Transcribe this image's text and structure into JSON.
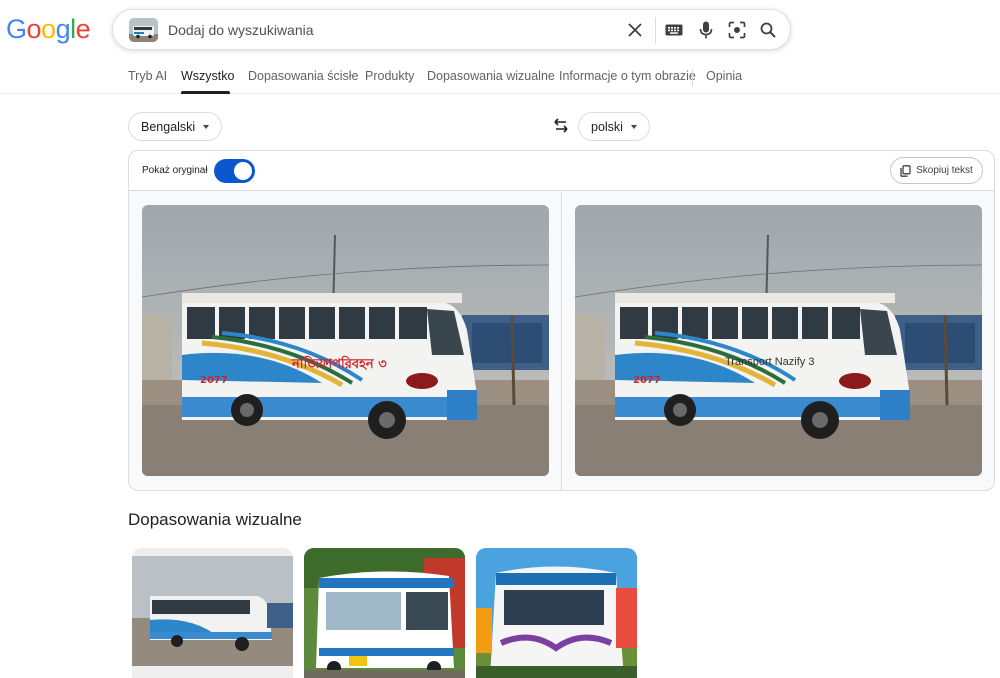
{
  "logo": {
    "text": "Google"
  },
  "search": {
    "placeholder": "Dodaj do wyszukiwania"
  },
  "header_icons": [
    "close-icon",
    "keyboard-icon",
    "mic-icon",
    "lens-icon",
    "search-icon"
  ],
  "tabs": [
    {
      "label": "Tryb AI"
    },
    {
      "label": "Wszystko"
    },
    {
      "label": "Dopasowania ścisłe"
    },
    {
      "label": "Produkty"
    },
    {
      "label": "Dopasowania wizualne"
    },
    {
      "label": "Informacje o tym obrazie"
    },
    {
      "label": "Opinia"
    }
  ],
  "active_tab": "Wszystko",
  "translate": {
    "source_lang": "Bengalski",
    "target_lang": "polski",
    "show_original_label": "Pokaż oryginał",
    "show_original_on": true,
    "copy_label": "Skopiuj tekst",
    "original_sign": "নাজিফাপরিবহন ৩",
    "translated_sign": "Transport Nazify 3",
    "bus_number": "2077"
  },
  "visual_matches": {
    "title": "Dopasowania wizualne",
    "items": [
      {
        "name": "match-1"
      },
      {
        "name": "match-2"
      },
      {
        "name": "match-3"
      }
    ]
  },
  "colors": {
    "google_blue": "#4285F4",
    "google_red": "#EA4335",
    "google_yellow": "#FBBC05",
    "google_green": "#34A853",
    "toggle_blue": "#0b57d0"
  }
}
